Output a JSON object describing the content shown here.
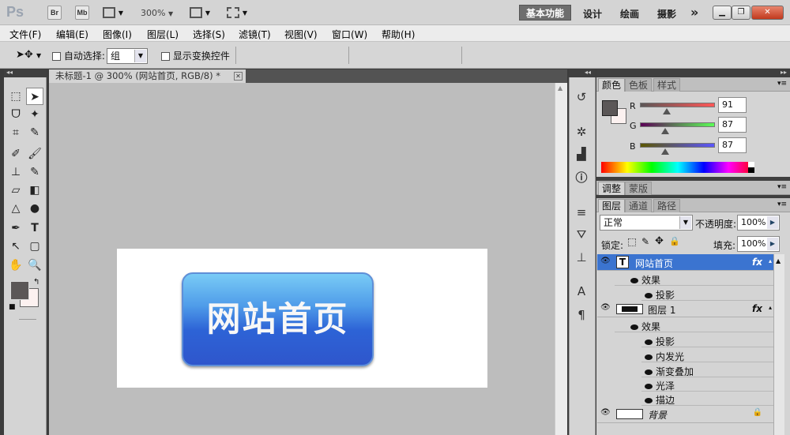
{
  "app": {
    "logo": "Ps",
    "bridge_btn": "Br",
    "minibridge_btn": "Mb",
    "zoom": "300%",
    "workspaces": {
      "active": "基本功能",
      "items": [
        "设计",
        "绘画",
        "摄影"
      ],
      "more": "»"
    }
  },
  "menu": [
    "文件(F)",
    "编辑(E)",
    "图像(I)",
    "图层(L)",
    "选择(S)",
    "滤镜(T)",
    "视图(V)",
    "窗口(W)",
    "帮助(H)"
  ],
  "options": {
    "auto_select_label": "自动选择:",
    "auto_select_value": "组",
    "show_transform_label": "显示变换控件"
  },
  "document": {
    "tab_title": "未标题-1 @ 300% (网站首页, RGB/8) *",
    "button_text": "网站首页"
  },
  "color_panel": {
    "tabs": [
      "颜色",
      "色板",
      "样式"
    ],
    "r_label": "R",
    "g_label": "G",
    "b_label": "B",
    "r": "91",
    "g": "87",
    "b": "87",
    "fg_color": "#5b5757",
    "r_fraction": 0.357,
    "g_fraction": 0.341,
    "b_fraction": 0.341
  },
  "adjust_panel": {
    "tabs": [
      "调整",
      "蒙版"
    ]
  },
  "layers_panel": {
    "tabs": [
      "图层",
      "通道",
      "路径"
    ],
    "blend_mode": "正常",
    "opacity_label": "不透明度:",
    "opacity": "100%",
    "lock_label": "锁定:",
    "fill_label": "填充:",
    "fill": "100%",
    "fx": "fx",
    "layers": [
      {
        "name": "网站首页",
        "effects_label": "效果",
        "effects": [
          "投影"
        ]
      },
      {
        "name": "图层 1",
        "effects_label": "效果",
        "effects": [
          "投影",
          "内发光",
          "渐变叠加",
          "光泽",
          "描边"
        ]
      },
      {
        "name": "背景"
      }
    ]
  }
}
